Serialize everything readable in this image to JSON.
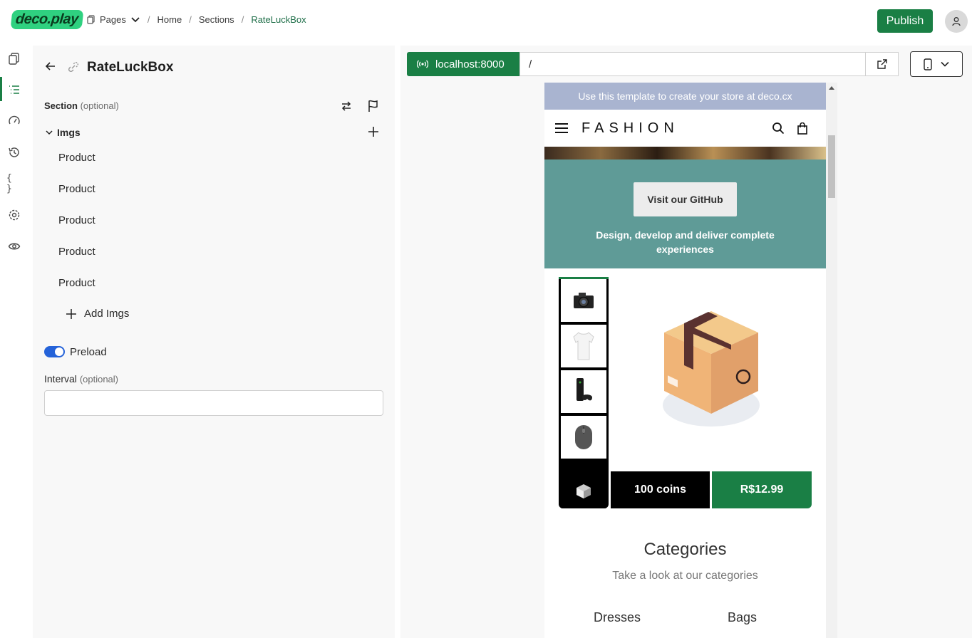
{
  "app": {
    "logo": "deco.play",
    "breadcrumb": {
      "pages_label": "Pages",
      "items": [
        "Home",
        "Sections",
        "RateLuckBox"
      ]
    },
    "publish_label": "Publish"
  },
  "rail": {
    "icons": [
      "pages-icon",
      "sections-icon",
      "performance-icon",
      "history-icon",
      "code-icon",
      "settings-icon",
      "preview-icon"
    ]
  },
  "editor": {
    "title": "RateLuckBox",
    "section_label": "Section",
    "optional_text": "(optional)",
    "imgs_label": "Imgs",
    "img_items": [
      "Product",
      "Product",
      "Product",
      "Product",
      "Product"
    ],
    "add_imgs_label": "Add Imgs",
    "preload_label": "Preload",
    "preload_on": true,
    "interval_label": "Interval",
    "interval_value": ""
  },
  "preview": {
    "host": "localhost:8000",
    "path": "/",
    "site": {
      "banner": "Use this template to create your store at deco.cx",
      "brand": "FASHION",
      "hero_button": "Visit our GitHub",
      "hero_text": "Design, develop and deliver complete experiences",
      "coins": "100 coins",
      "price": "R$12.99",
      "categories_title": "Categories",
      "categories_subtitle": "Take a look at our categories",
      "categories": [
        "Dresses",
        "Bags"
      ]
    }
  },
  "colors": {
    "accent": "#1a7f45",
    "hero_bg": "#5f9b97",
    "banner_bg": "#a9b4d0",
    "toggle": "#2563d9"
  }
}
